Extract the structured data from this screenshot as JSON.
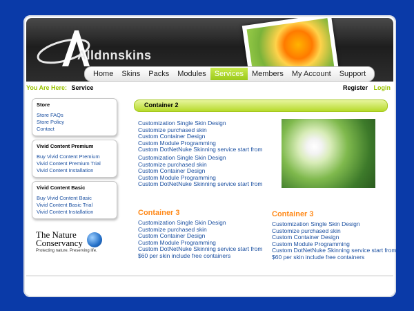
{
  "header": {
    "logo_text": "Alldnnskins",
    "logo_image": "orange-flower-photo"
  },
  "nav": {
    "items": [
      "Home",
      "Skins",
      "Packs",
      "Modules",
      "Services",
      "Members",
      "My Account",
      "Support"
    ],
    "active": "Services"
  },
  "breadcrumb": {
    "label": "You Are Here:",
    "value": "Service"
  },
  "auth": {
    "register": "Register",
    "login": "Login"
  },
  "sidebar": {
    "store": {
      "title": "Store",
      "links": [
        "Store FAQs",
        "Store Policy",
        "Contact"
      ]
    },
    "premium": {
      "title": "Vivid Content Premium",
      "links": [
        "Buy Vivid Content Premium",
        "Vivid Content Premium Trial",
        "Vivid Content Installation"
      ]
    },
    "basic": {
      "title": "Vivid Content Basic",
      "links": [
        "Buy Vivid Content Basic",
        "Vivid Content Basic Trial",
        "Vivid Content Installation"
      ]
    }
  },
  "tnc": {
    "line1": "The Nature",
    "line2": "Conservancy",
    "tagline": "Protecting nature. Preserving life."
  },
  "container2": {
    "title": "Container 2",
    "group1": [
      "Customization Single Skin Design",
      "Customize purchased skin",
      "Custom Container Design",
      "Custom Module Programming",
      "Custom DotNetNuke Skinning service start from"
    ],
    "group2": [
      "Customization Single Skin Design",
      "Customize purchased skin",
      "Custom Container Design",
      "Custom Module Programming",
      "Custom DotNetNuke Skinning service start from"
    ],
    "image": "white-daisy-photo"
  },
  "container3_left": {
    "title": "Container 3",
    "lines": [
      "Customization Single Skin Design",
      "Customize purchased skin",
      "Custom Container Design",
      "Custom Module Programming",
      "Custom DotNetNuke Skinning service start from",
      "$60 per skin include free containers"
    ]
  },
  "container3_right": {
    "title": "Container 3",
    "lines": [
      "Customization Single Skin Design",
      "Customize purchased skin",
      "Custom Container Design",
      "Custom Module Programming",
      "Custom DotNetNuke Skinning service start from",
      "$60 per skin include free containers"
    ]
  }
}
